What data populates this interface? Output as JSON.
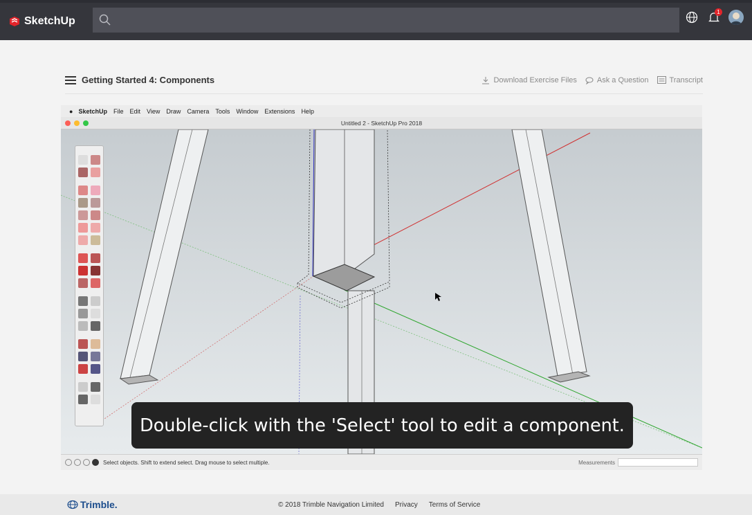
{
  "app": {
    "brand": "SketchUp"
  },
  "topbar": {
    "search_icon": "search-icon",
    "icons": [
      "globe-icon",
      "notification-bell-icon",
      "user-avatar"
    ],
    "notification_count": "1"
  },
  "course": {
    "title": "Getting Started 4: Components",
    "actions": {
      "download": "Download Exercise Files",
      "ask": "Ask a Question",
      "transcript": "Transcript"
    }
  },
  "video": {
    "menu": [
      "SketchUp",
      "File",
      "Edit",
      "View",
      "Draw",
      "Camera",
      "Tools",
      "Window",
      "Extensions",
      "Help"
    ],
    "window_title": "Untitled 2 - SketchUp Pro 2018",
    "status_text": "Select objects. Shift to extend select. Drag mouse to select multiple.",
    "measurements_label": "Measurements",
    "caption": "Double-click with the 'Select' tool to edit a component."
  },
  "footer": {
    "brand": "Trimble.",
    "copyright": "© 2018 Trimble Navigation Limited",
    "privacy": "Privacy",
    "terms": "Terms of Service"
  },
  "colors": {
    "topbar": "#35363c",
    "search": "#4f5058",
    "red_axis": "#d03030",
    "green_axis": "#30a030",
    "blue_axis": "#3030c0",
    "brand_red": "#e2242a",
    "trimble_blue": "#1b4c8c"
  }
}
